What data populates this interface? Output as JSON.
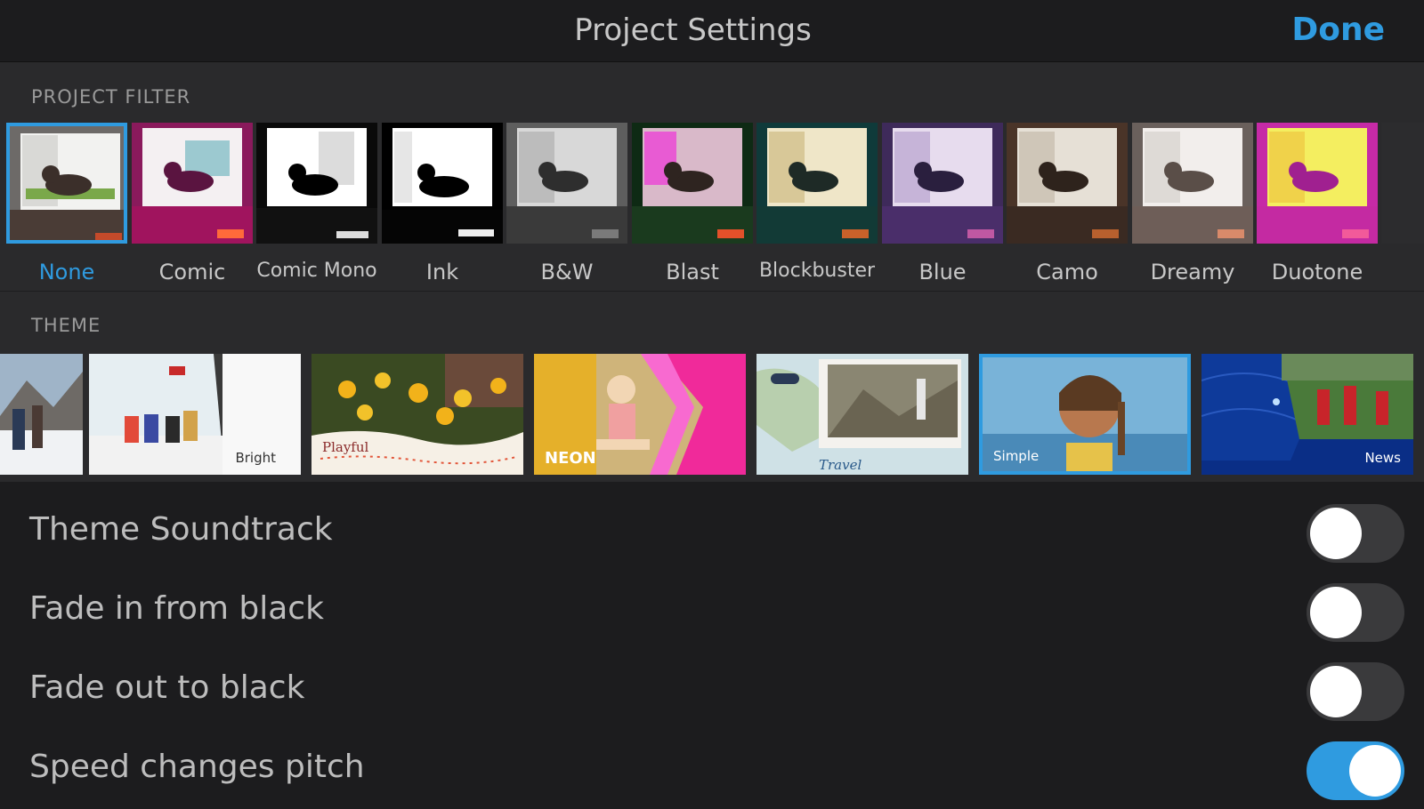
{
  "nav": {
    "title": "Project Settings",
    "done_label": "Done"
  },
  "filters": {
    "header": "PROJECT FILTER",
    "selected": "None",
    "items": [
      {
        "label": "None"
      },
      {
        "label": "Comic"
      },
      {
        "label": "Comic Mono"
      },
      {
        "label": "Ink"
      },
      {
        "label": "B&W"
      },
      {
        "label": "Blast"
      },
      {
        "label": "Blockbuster"
      },
      {
        "label": "Blue"
      },
      {
        "label": "Camo"
      },
      {
        "label": "Dreamy"
      },
      {
        "label": "Duotone"
      }
    ]
  },
  "theme": {
    "header": "THEME",
    "selected": "Simple",
    "items": [
      {
        "caption": ""
      },
      {
        "caption": "Bright"
      },
      {
        "caption": "Playful"
      },
      {
        "caption": "NEON"
      },
      {
        "caption": "Travel"
      },
      {
        "caption": "Simple"
      },
      {
        "caption": "News"
      }
    ]
  },
  "settings": [
    {
      "label": "Theme Soundtrack",
      "on": false
    },
    {
      "label": "Fade in from black",
      "on": false
    },
    {
      "label": "Fade out to black",
      "on": false
    },
    {
      "label": "Speed changes pitch",
      "on": true
    }
  ],
  "colors": {
    "accent": "#2f9be0",
    "background": "#1c1c1e",
    "section_background": "#2a2a2c"
  }
}
